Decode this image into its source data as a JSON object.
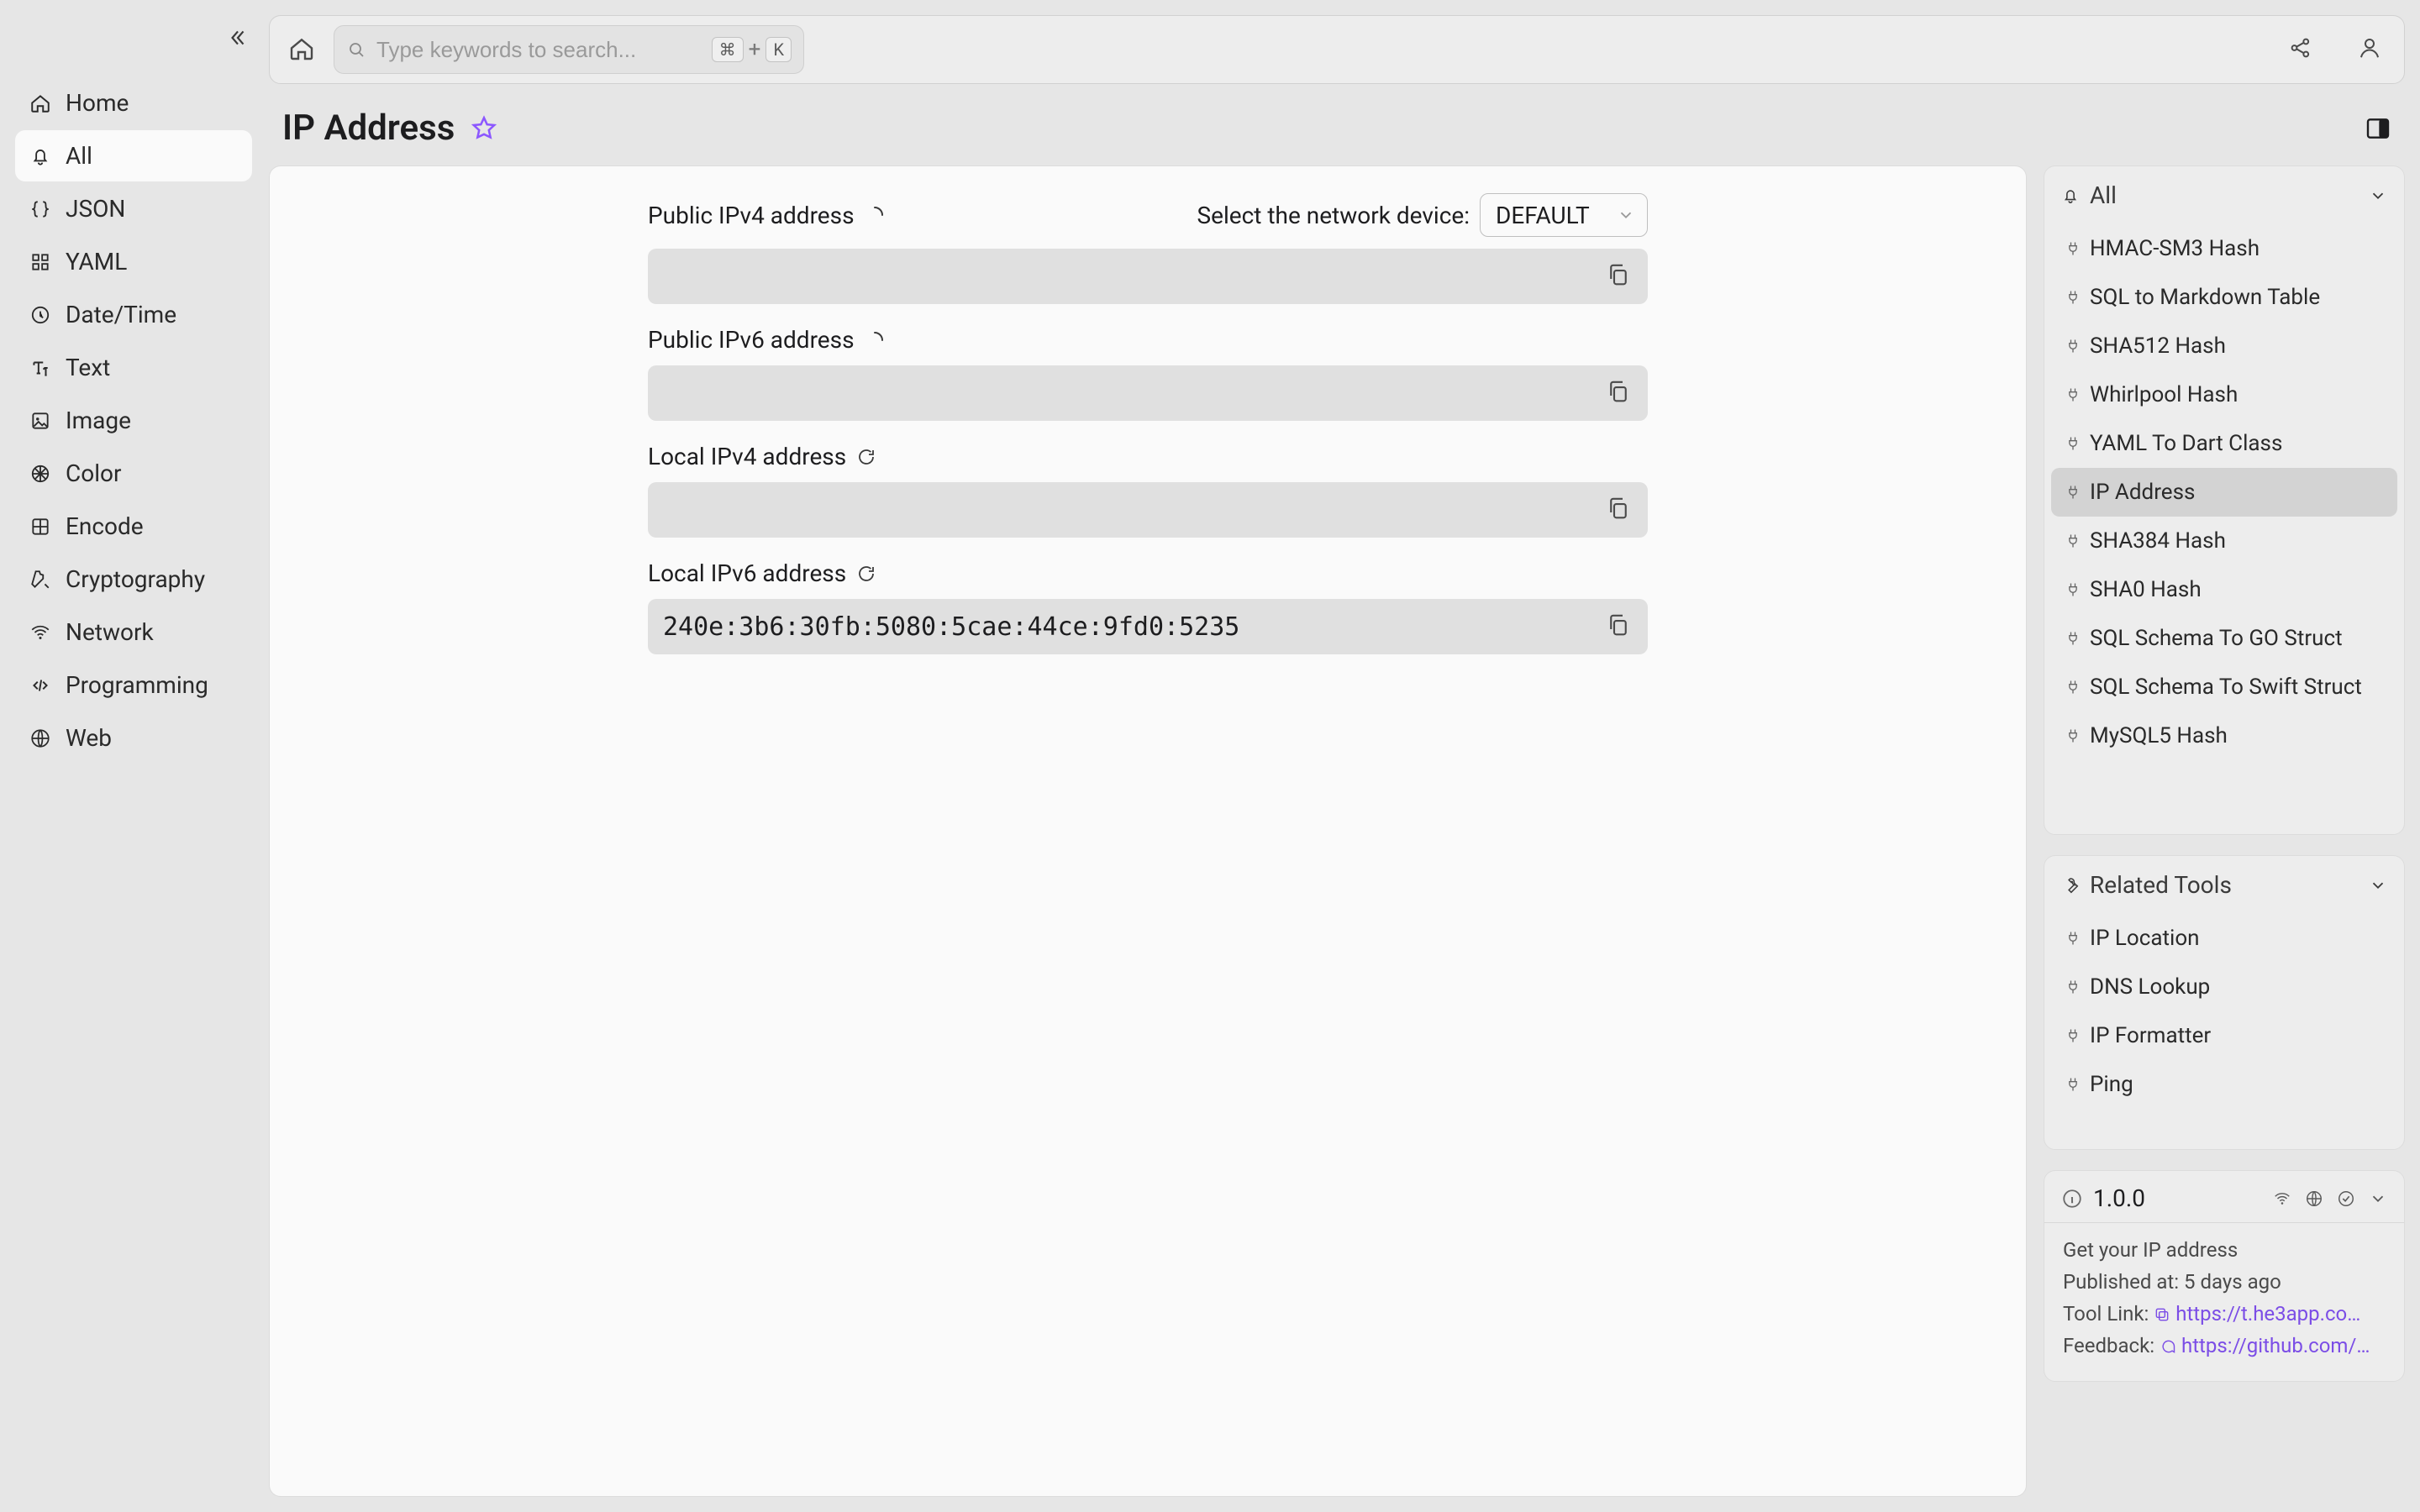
{
  "search": {
    "placeholder": "Type keywords to search...",
    "shortcut": {
      "mod": "⌘",
      "plus": "+",
      "key": "K"
    }
  },
  "sidebar": {
    "items": [
      {
        "label": "Home"
      },
      {
        "label": "All"
      },
      {
        "label": "JSON"
      },
      {
        "label": "YAML"
      },
      {
        "label": "Date/Time"
      },
      {
        "label": "Text"
      },
      {
        "label": "Image"
      },
      {
        "label": "Color"
      },
      {
        "label": "Encode"
      },
      {
        "label": "Cryptography"
      },
      {
        "label": "Network"
      },
      {
        "label": "Programming"
      },
      {
        "label": "Web"
      }
    ],
    "activeIndex": 1
  },
  "page": {
    "title": "IP Address"
  },
  "device": {
    "label": "Select the network device:",
    "selected": "DEFAULT"
  },
  "fields": {
    "publicV4": {
      "label": "Public IPv4 address",
      "value": ""
    },
    "publicV6": {
      "label": "Public IPv6 address",
      "value": ""
    },
    "localV4": {
      "label": "Local IPv4 address",
      "value": ""
    },
    "localV6": {
      "label": "Local IPv6 address",
      "value": "240e:3b6:30fb:5080:5cae:44ce:9fd0:5235"
    }
  },
  "rightAll": {
    "title": "All",
    "items": [
      "HMAC-SM3 Hash",
      "SQL to Markdown Table",
      "SHA512 Hash",
      "Whirlpool Hash",
      "YAML To Dart Class",
      "IP Address",
      "SHA384 Hash",
      "SHA0 Hash",
      "SQL Schema To GO Struct",
      "SQL Schema To Swift Struct",
      "MySQL5 Hash"
    ],
    "activeIndex": 5
  },
  "related": {
    "title": "Related Tools",
    "items": [
      "IP Location",
      "DNS Lookup",
      "IP Formatter",
      "Ping"
    ]
  },
  "info": {
    "version": "1.0.0",
    "description": "Get your IP address",
    "published_label": "Published at:",
    "published_value": "5 days ago",
    "link_label": "Tool Link:",
    "link_value": "https://t.he3app.co…",
    "feedback_label": "Feedback:",
    "feedback_value": "https://github.com/…"
  }
}
